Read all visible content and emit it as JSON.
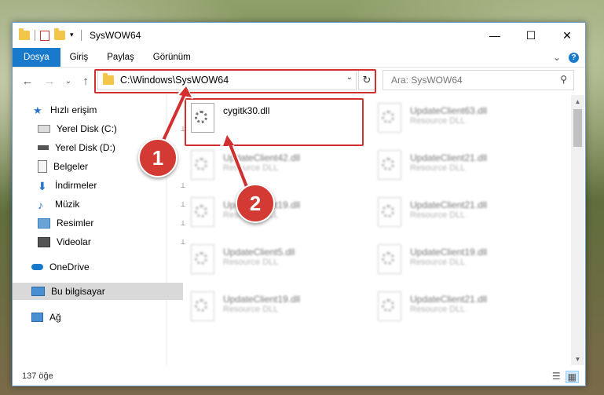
{
  "window": {
    "title": "SysWOW64",
    "minimize": "—",
    "maximize": "☐",
    "close": "✕"
  },
  "ribbon": {
    "tabs": [
      "Dosya",
      "Giriş",
      "Paylaş",
      "Görünüm"
    ],
    "expand": "⌄",
    "help": "?"
  },
  "nav": {
    "back": "←",
    "forward": "→",
    "recent": "⌄",
    "up": "↑",
    "address": "C:\\Windows\\SysWOW64",
    "dropdown": "⌄",
    "refresh": "↻",
    "search_placeholder": "Ara: SysWOW64",
    "search_icon": "⚲"
  },
  "sidebar": {
    "items": [
      {
        "label": "Hızlı erişim",
        "icon": "star-icon"
      },
      {
        "label": "Yerel Disk (C:)",
        "icon": "disk-icon",
        "pinned": true
      },
      {
        "label": "Yerel Disk (D:)",
        "icon": "disk-icon",
        "pinned": false
      },
      {
        "label": "Belgeler",
        "icon": "documents-icon",
        "pinned": false
      },
      {
        "label": "İndirmeler",
        "icon": "download-icon",
        "pinned": true
      },
      {
        "label": "Müzik",
        "icon": "music-icon",
        "pinned": true
      },
      {
        "label": "Resimler",
        "icon": "pictures-icon",
        "pinned": true
      },
      {
        "label": "Videolar",
        "icon": "videos-icon",
        "pinned": true
      },
      {
        "label": "OneDrive",
        "icon": "cloud-icon"
      },
      {
        "label": "Bu bilgisayar",
        "icon": "computer-icon",
        "selected": true
      },
      {
        "label": "Ağ",
        "icon": "network-icon"
      }
    ],
    "pin_glyph": "📌"
  },
  "files": [
    {
      "name": "cygitk30.dll",
      "type": "",
      "focused": true
    },
    {
      "name": "UpdateClient63.dll",
      "type": "Resource DLL"
    },
    {
      "name": "UpdateClient42.dll",
      "type": "Resource DLL"
    },
    {
      "name": "UpdateClient21.dll",
      "type": "Resource DLL"
    },
    {
      "name": "UpdateClient19.dll",
      "type": "Resource DLL"
    },
    {
      "name": "UpdateClient21.dll",
      "type": "Resource DLL"
    },
    {
      "name": "UpdateClient5.dll",
      "type": "Resource DLL"
    },
    {
      "name": "UpdateClient19.dll",
      "type": "Resource DLL"
    },
    {
      "name": "UpdateClient19.dll",
      "type": "Resource DLL"
    },
    {
      "name": "UpdateClient21.dll",
      "type": "Resource DLL"
    }
  ],
  "status": {
    "count": "137 öğe"
  },
  "callouts": [
    "1",
    "2"
  ],
  "colors": {
    "accent": "#1979ca",
    "highlight": "#d32f2f"
  }
}
